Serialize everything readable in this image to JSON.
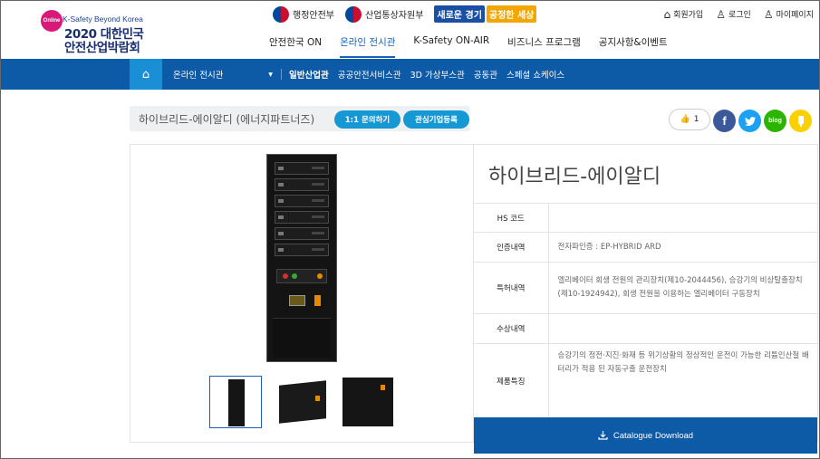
{
  "logo": {
    "badge": "Online",
    "subtitle": "K-Safety Beyond Korea",
    "line1": "2020 대한민국",
    "line2": "안전산업박람회"
  },
  "gov": {
    "ministry1": "행정안전부",
    "ministry2": "산업통상자원부",
    "slogan1": "새로운 경기",
    "slogan2": "공정한 세상"
  },
  "util": {
    "signup": "회원가입",
    "login": "로그인",
    "mypage": "마이페이지"
  },
  "gnb": [
    {
      "label": "안전한국 ON"
    },
    {
      "label": "온라인 전시관"
    },
    {
      "label": "K-Safety ON-AIR"
    },
    {
      "label": "비즈니스 프로그램"
    },
    {
      "label": "공지사항&이벤트"
    }
  ],
  "navbar": {
    "home_icon": "home-icon",
    "category": "온라인 전시관",
    "subnav": [
      {
        "label": "일반산업관"
      },
      {
        "label": "공공안전서비스관"
      },
      {
        "label": "3D 가상부스관"
      },
      {
        "label": "공동관"
      },
      {
        "label": "스페셜 쇼케이스"
      }
    ]
  },
  "product": {
    "title_bar": "하이브리드-에이알디 (에너지파트너즈)",
    "inquiry_label": "1:1 문의하기",
    "fav_label": "관심기업등록",
    "like_count": "1",
    "name": "하이브리드-에이알디",
    "download_label": "Catalogue Download"
  },
  "share": {
    "facebook": "f",
    "twitter": "t",
    "blog": "blog",
    "talk": "t"
  },
  "info": [
    {
      "label": "HS 코드",
      "value": ""
    },
    {
      "label": "인증내역",
      "value": "전자파인증 : EP-HYBRID ARD"
    },
    {
      "label": "특허내역",
      "value": "엘리베이터 회생 전원의 관리장치(제10-2044456), 승강기의 비상탈출장치(제10-1924942), 회생 전원을 이용하는 엘리베이터 구동장치"
    },
    {
      "label": "수상내역",
      "value": ""
    },
    {
      "label": "제품특징",
      "value": "승강기의 정전·지진·화재 등 위기상황의 정상적인 운전이 가능한 리튬인산철 배터리가 적용 된 자동구출 운전장치"
    }
  ],
  "colors": {
    "primary_blue": "#0d5aa7",
    "accent_blue": "#1598d4",
    "home_blue": "#1a8fd6",
    "badge_pink": "#d9197a"
  }
}
